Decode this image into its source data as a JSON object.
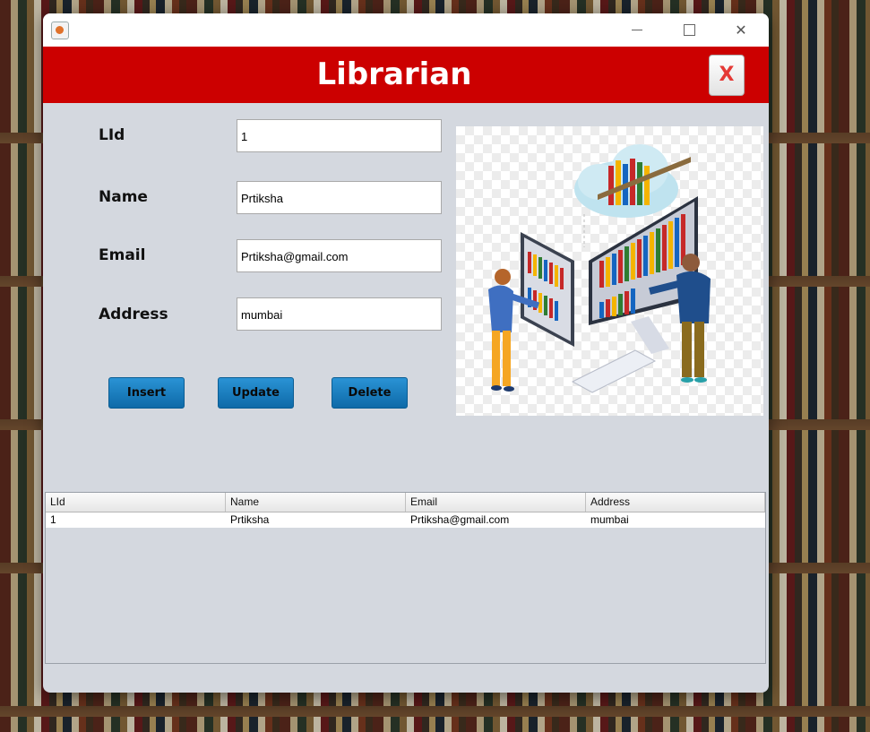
{
  "window": {
    "header_title": "Librarian",
    "close_label": "X"
  },
  "form": {
    "fields": [
      {
        "label": "LId",
        "value": "1"
      },
      {
        "label": "Name",
        "value": "Prtiksha"
      },
      {
        "label": "Email",
        "value": "Prtiksha@gmail.com"
      },
      {
        "label": "Address",
        "value": "mumbai"
      }
    ]
  },
  "buttons": {
    "insert": "Insert",
    "update": "Update",
    "delete": "Delete"
  },
  "table": {
    "columns": [
      "LId",
      "Name",
      "Email",
      "Address"
    ],
    "rows": [
      [
        "1",
        "Prtiksha",
        "Prtiksha@gmail.com",
        "mumbai"
      ]
    ]
  },
  "colors": {
    "header": "#cc0000",
    "button": "#1a7fc4",
    "panel": "#d4d8df"
  },
  "icons": {
    "app": "java-icon",
    "minimize": "minimize-icon",
    "maximize": "maximize-icon",
    "close": "close-icon"
  }
}
